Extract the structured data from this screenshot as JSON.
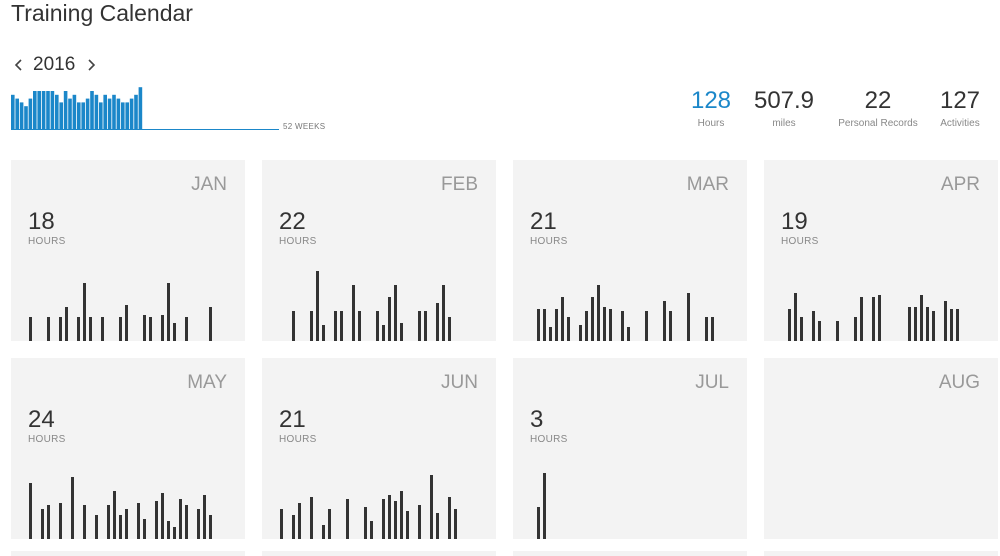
{
  "page": {
    "title": "Training Calendar"
  },
  "year_nav": {
    "prev_icon": "chevron-left-icon",
    "year": "2016",
    "next_icon": "chevron-right-icon"
  },
  "weeks_chart": {
    "label": "52 WEEKS",
    "color": "#1b87c9",
    "values": [
      9,
      8,
      7,
      6,
      8,
      10,
      10,
      10,
      10,
      10,
      9,
      7,
      10,
      8,
      9,
      7,
      7,
      8,
      10,
      9,
      7,
      9,
      8,
      9,
      8,
      7,
      7,
      8,
      9,
      11
    ]
  },
  "stats": [
    {
      "value": "128",
      "label": "Hours"
    },
    {
      "value": "507.9",
      "label": "miles"
    },
    {
      "value": "22",
      "label": "Personal Records"
    },
    {
      "value": "127",
      "label": "Activities"
    }
  ],
  "months": [
    {
      "name": "JAN",
      "hours": "18",
      "hours_label": "HOURS",
      "bars": [
        [
          18,
          24
        ],
        [
          36,
          24
        ],
        [
          48,
          24
        ],
        [
          54,
          34
        ],
        [
          66,
          24
        ],
        [
          72,
          58
        ],
        [
          78,
          24
        ],
        [
          90,
          24
        ],
        [
          108,
          24
        ],
        [
          114,
          36
        ],
        [
          132,
          26
        ],
        [
          138,
          24
        ],
        [
          150,
          26
        ],
        [
          156,
          58
        ],
        [
          162,
          18
        ],
        [
          174,
          24
        ],
        [
          198,
          34
        ]
      ]
    },
    {
      "name": "FEB",
      "hours": "22",
      "hours_label": "HOURS",
      "bars": [
        [
          30,
          30
        ],
        [
          48,
          30
        ],
        [
          54,
          70
        ],
        [
          60,
          16
        ],
        [
          72,
          30
        ],
        [
          78,
          30
        ],
        [
          90,
          56
        ],
        [
          96,
          30
        ],
        [
          114,
          30
        ],
        [
          120,
          16
        ],
        [
          126,
          44
        ],
        [
          132,
          56
        ],
        [
          138,
          18
        ],
        [
          156,
          30
        ],
        [
          162,
          30
        ],
        [
          174,
          38
        ],
        [
          180,
          56
        ],
        [
          186,
          24
        ]
      ]
    },
    {
      "name": "MAR",
      "hours": "21",
      "hours_label": "HOURS",
      "bars": [
        [
          24,
          32
        ],
        [
          30,
          32
        ],
        [
          36,
          14
        ],
        [
          42,
          32
        ],
        [
          48,
          44
        ],
        [
          54,
          24
        ],
        [
          66,
          16
        ],
        [
          72,
          30
        ],
        [
          78,
          44
        ],
        [
          84,
          56
        ],
        [
          90,
          34
        ],
        [
          96,
          32
        ],
        [
          108,
          30
        ],
        [
          114,
          14
        ],
        [
          132,
          30
        ],
        [
          150,
          40
        ],
        [
          156,
          30
        ],
        [
          174,
          48
        ],
        [
          192,
          24
        ],
        [
          198,
          24
        ]
      ]
    },
    {
      "name": "APR",
      "hours": "19",
      "hours_label": "HOURS",
      "bars": [
        [
          24,
          32
        ],
        [
          30,
          48
        ],
        [
          36,
          24
        ],
        [
          48,
          30
        ],
        [
          54,
          20
        ],
        [
          72,
          20
        ],
        [
          90,
          24
        ],
        [
          96,
          44
        ],
        [
          108,
          44
        ],
        [
          114,
          46
        ],
        [
          144,
          34
        ],
        [
          150,
          34
        ],
        [
          156,
          46
        ],
        [
          162,
          34
        ],
        [
          168,
          30
        ],
        [
          180,
          40
        ],
        [
          186,
          32
        ],
        [
          192,
          32
        ]
      ]
    },
    {
      "name": "MAY",
      "hours": "24",
      "hours_label": "HOURS",
      "bars": [
        [
          18,
          56
        ],
        [
          30,
          30
        ],
        [
          36,
          34
        ],
        [
          48,
          36
        ],
        [
          60,
          62
        ],
        [
          72,
          34
        ],
        [
          84,
          24
        ],
        [
          96,
          34
        ],
        [
          102,
          48
        ],
        [
          108,
          24
        ],
        [
          114,
          30
        ],
        [
          126,
          36
        ],
        [
          132,
          20
        ],
        [
          144,
          38
        ],
        [
          150,
          46
        ],
        [
          156,
          18
        ],
        [
          162,
          12
        ],
        [
          168,
          40
        ],
        [
          174,
          34
        ],
        [
          186,
          30
        ],
        [
          192,
          44
        ],
        [
          198,
          24
        ]
      ]
    },
    {
      "name": "JUN",
      "hours": "21",
      "hours_label": "HOURS",
      "bars": [
        [
          18,
          30
        ],
        [
          30,
          24
        ],
        [
          36,
          36
        ],
        [
          48,
          42
        ],
        [
          60,
          14
        ],
        [
          66,
          30
        ],
        [
          84,
          40
        ],
        [
          102,
          32
        ],
        [
          108,
          18
        ],
        [
          120,
          40
        ],
        [
          126,
          44
        ],
        [
          132,
          38
        ],
        [
          138,
          48
        ],
        [
          144,
          28
        ],
        [
          156,
          34
        ],
        [
          168,
          64
        ],
        [
          174,
          26
        ],
        [
          186,
          42
        ],
        [
          192,
          30
        ]
      ]
    },
    {
      "name": "JUL",
      "hours": "3",
      "hours_label": "HOURS",
      "bars": [
        [
          24,
          32
        ],
        [
          30,
          66
        ]
      ]
    },
    {
      "name": "AUG",
      "hours": "",
      "hours_label": "",
      "bars": []
    }
  ]
}
